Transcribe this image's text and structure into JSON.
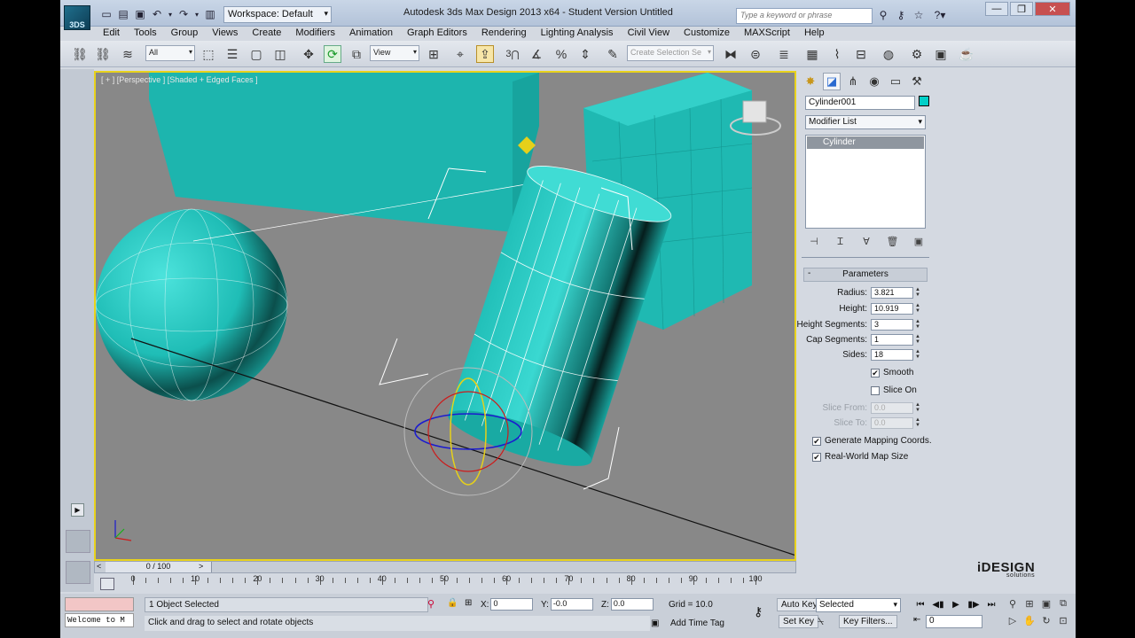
{
  "title_bar": {
    "workspace": "Workspace: Default",
    "window_title": "Autodesk 3ds Max Design 2013 x64  -  Student Version    Untitled",
    "search_placeholder": "Type a keyword or phrase",
    "logo_text": "3DS"
  },
  "menu": [
    "Edit",
    "Tools",
    "Group",
    "Views",
    "Create",
    "Modifiers",
    "Animation",
    "Graph Editors",
    "Rendering",
    "Lighting Analysis",
    "Civil View",
    "Customize",
    "MAXScript",
    "Help"
  ],
  "toolbar": {
    "filter": "All",
    "ref_coord": "View",
    "selection_set": "Create Selection Se",
    "snap_label": "3"
  },
  "viewport": {
    "label": "[ + ] [Perspective ] [Shaded + Edged Faces ]"
  },
  "command_panel": {
    "object_name": "Cylinder001",
    "modifier_list": "Modifier List",
    "stack_item": "Cylinder",
    "object_color": "#00cfc8",
    "rollout_title": "Parameters",
    "params": [
      {
        "label": "Radius:",
        "value": "3.821"
      },
      {
        "label": "Height:",
        "value": "10.919"
      },
      {
        "label": "Height Segments:",
        "value": "3"
      },
      {
        "label": "Cap Segments:",
        "value": "1"
      },
      {
        "label": "Sides:",
        "value": "18"
      }
    ],
    "smooth": "Smooth",
    "slice_on": "Slice On",
    "slice_from": {
      "label": "Slice From:",
      "value": "0.0"
    },
    "slice_to": {
      "label": "Slice To:",
      "value": "0.0"
    },
    "gen_mapping": "Generate Mapping Coords.",
    "real_world": "Real-World Map Size"
  },
  "timeline": {
    "frame_display": "0 / 100",
    "ticks": [
      "0",
      "10",
      "20",
      "30",
      "40",
      "50",
      "60",
      "70",
      "80",
      "90",
      "100"
    ]
  },
  "status": {
    "selection": "1 Object Selected",
    "prompt": "Click and drag to select and rotate objects",
    "listener": "Welcome to M",
    "x_label": "X:",
    "x_value": "0",
    "y_label": "Y:",
    "y_value": "-0.0",
    "z_label": "Z:",
    "z_value": "0.0",
    "grid": "Grid = 10.0",
    "add_time_tag": "Add Time Tag",
    "auto_key": "Auto Key",
    "set_key": "Set Key",
    "key_mode": "Selected",
    "key_filters": "Key Filters...",
    "current_frame": "0"
  },
  "watermark": {
    "brand": "iDESIGN",
    "sub": "solutions"
  }
}
